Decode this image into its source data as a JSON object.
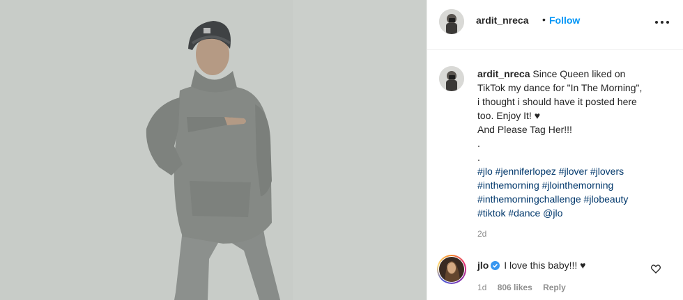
{
  "post": {
    "username": "ardit_nreca",
    "dot": "•",
    "follow_label": "Follow",
    "more_icon": "more-options-icon"
  },
  "caption": {
    "username": "ardit_nreca",
    "lines": [
      "Since Queen liked on",
      "TikTok my dance for \"In The Morning\",",
      "i thought i should have it posted here",
      "too. Enjoy It! ♥",
      "And Please Tag Her!!!",
      ".",
      "."
    ],
    "hashtag_lines": [
      "#jlo #jenniferlopez #jlover #jlovers",
      "#inthemorning #jlointhemorning",
      "#inthemorningchallenge #jlobeauty",
      "#tiktok #dance @jlo"
    ],
    "time": "2d"
  },
  "comment": {
    "username": "jlo",
    "text": "I love this baby!!! ♥",
    "verified_icon": "verified-badge-icon",
    "time": "1d",
    "likes": "806 likes",
    "reply_label": "Reply",
    "like_icon": "heart-outline-icon"
  },
  "colors": {
    "link_blue": "#0095f6",
    "hashtag": "#00376b",
    "meta_gray": "#8e8e8e",
    "text": "#262626"
  }
}
